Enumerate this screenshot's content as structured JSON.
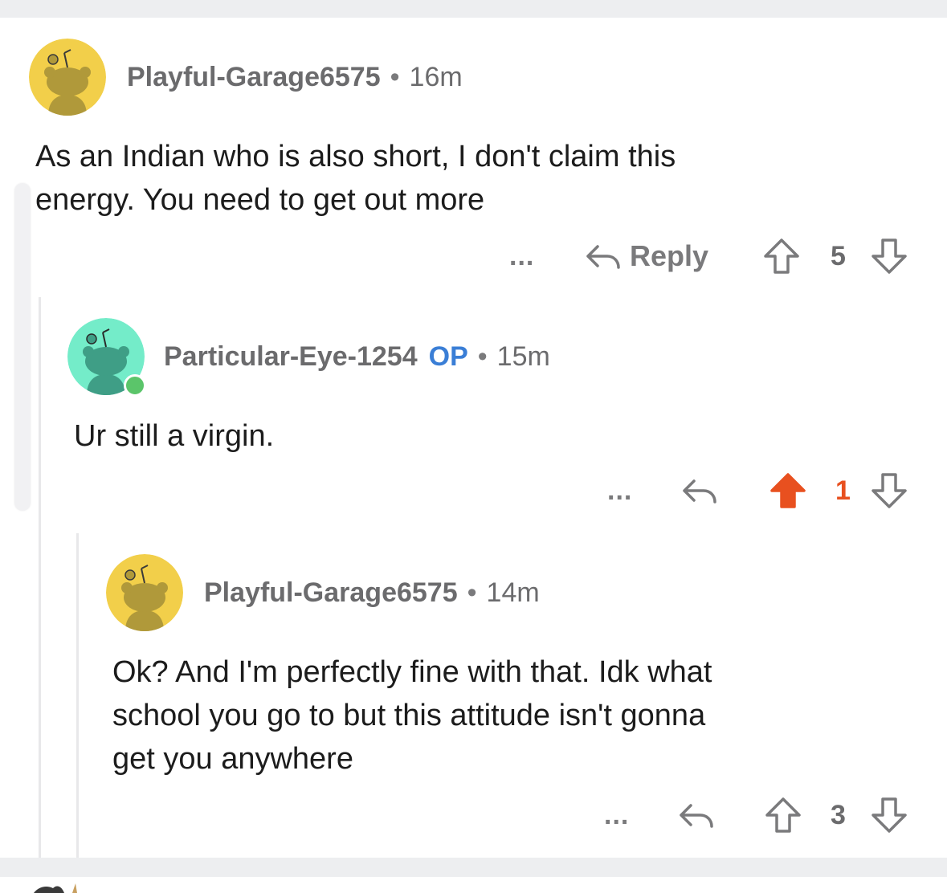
{
  "comments": [
    {
      "username": "Playful-Garage6575",
      "separator": "•",
      "time": "16m",
      "text_lines": [
        "As an Indian who is also short, I don't claim this",
        "energy. You need to get out more"
      ],
      "more": "...",
      "reply_label": "Reply",
      "score": "5",
      "upvoted": false,
      "avatar_color": "#f2cf4a"
    },
    {
      "username": "Particular-Eye-1254",
      "op_badge": "OP",
      "separator": "•",
      "time": "15m",
      "text_lines": [
        "Ur still a virgin."
      ],
      "more": "...",
      "score": "1",
      "upvoted": true,
      "online": true,
      "avatar_color": "#74ecc9"
    },
    {
      "username": "Playful-Garage6575",
      "separator": "•",
      "time": "14m",
      "text_lines": [
        "Ok? And I'm perfectly fine with that. Idk what",
        "school you go to but this attitude isn't gonna",
        "get you anywhere"
      ],
      "more": "...",
      "score": "3",
      "upvoted": false,
      "avatar_color": "#f2cf4a"
    }
  ],
  "colors": {
    "upvote_active": "#e8501f",
    "op_badge": "#3a7ed6",
    "muted_text": "#7a7a7c",
    "online_dot": "#5bc56a"
  },
  "icons": [
    "snoo-avatar-icon",
    "reply-arrow-icon",
    "upvote-arrow-icon",
    "downvote-arrow-icon",
    "more-options-icon"
  ]
}
